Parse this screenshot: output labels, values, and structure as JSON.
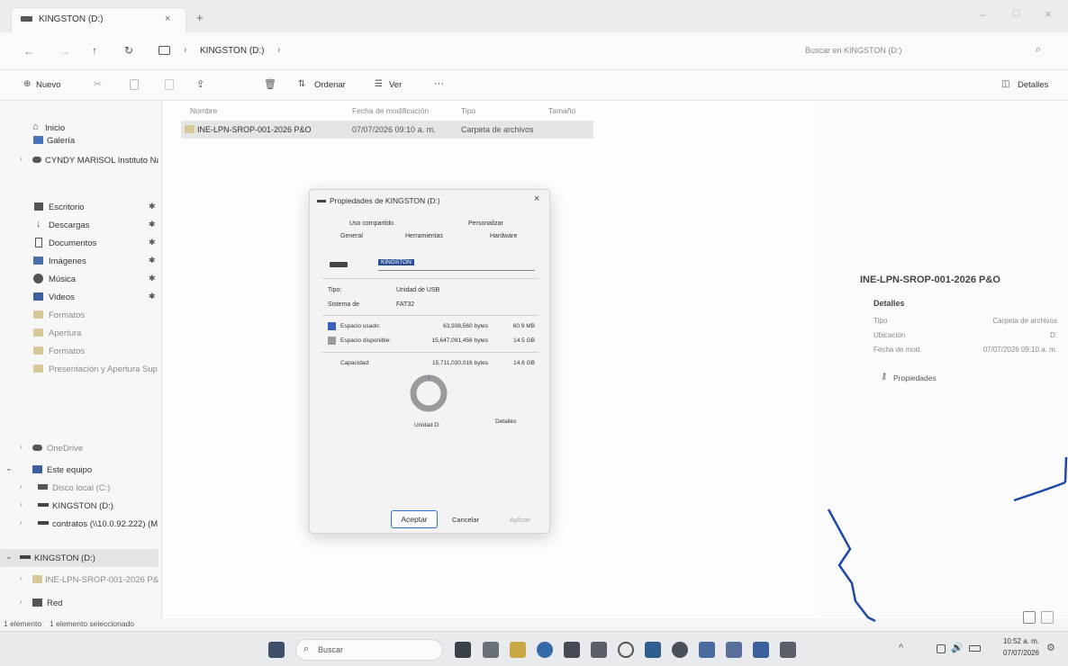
{
  "window": {
    "tab_title": "KINGSTON (D:)",
    "tab_close": "×",
    "new_tab": "+",
    "controls": [
      "–",
      "□",
      "×"
    ]
  },
  "addressbar": {
    "path": "KINGSTON (D:)",
    "search_placeholder": "Buscar en KINGSTON (D:)"
  },
  "toolbar": {
    "new_label": "Nuevo",
    "sort_label": "Ordenar",
    "view_label": "Ver",
    "more_label": "···",
    "details_label": "Detalles"
  },
  "sidebar": {
    "items": [
      {
        "label": "Inicio"
      },
      {
        "label": "Galería"
      },
      {
        "label": "CYNDY MARISOL Instituto Nal"
      },
      {
        "label": "Escritorio"
      },
      {
        "label": "Descargas"
      },
      {
        "label": "Documentos"
      },
      {
        "label": "Imágenes"
      },
      {
        "label": "Música"
      },
      {
        "label": "Videos"
      },
      {
        "label": "Formatos"
      },
      {
        "label": "Apertura"
      },
      {
        "label": "Formatos"
      },
      {
        "label": "Presentación y Apertura Sup Pl"
      },
      {
        "label": "OneDrive"
      },
      {
        "label": "Este equipo"
      },
      {
        "label": "Disco local (C:)"
      },
      {
        "label": "KINGSTON (D:)"
      },
      {
        "label": "contratos (\\\\10.0.92.222) (M"
      },
      {
        "label": "KINGSTON (D:)"
      },
      {
        "label": "INE-LPN-SROP-001-2026 P&"
      },
      {
        "label": "Red"
      }
    ],
    "pin_glyph": "✱"
  },
  "file_list": {
    "columns": [
      "Nombre",
      "Fecha de modificación",
      "Tipo",
      "Tamaño"
    ],
    "rows": [
      {
        "name": "INE-LPN-SROP-001-2026 P&O",
        "date": "07/07/2026 09:10 a. m.",
        "type": "Carpeta de archivos",
        "size": ""
      }
    ]
  },
  "dialog": {
    "title": "Propiedades de KINGSTON (D:)",
    "close": "×",
    "tabs_row1": [
      "Uso compartido",
      "Personalizar"
    ],
    "tabs_row2": [
      "General",
      "Herramientas",
      "Hardware"
    ],
    "volume_label": "KINGSTON",
    "type_label": "Tipo:",
    "type_value": "Unidad de USB",
    "fs_label": "Sistema de",
    "fs_value": "FAT32",
    "used_label": "Espacio usado:",
    "used_bytes": "63,938,560 bytes",
    "used_size": "60.9 MB",
    "free_label": "Espacio disponible:",
    "free_bytes": "15,647,091,456 bytes",
    "free_size": "14.5 GB",
    "capacity_label": "Capacidad:",
    "capacity_bytes": "15,711,030,016 bytes",
    "capacity_size": "14.6 GB",
    "used_fraction": 0.004,
    "drive_label": "Unidad D:",
    "details_button": "Detalles",
    "accept": "Aceptar",
    "cancel": "Cancelar",
    "apply": "Aplicar"
  },
  "details_pane": {
    "title": "INE-LPN-SROP-001-2026 P&O",
    "section": "Detalles",
    "rows": [
      {
        "k": "Tipo",
        "v": "Carpeta de archivos"
      },
      {
        "k": "Ubicación",
        "v": "D:"
      },
      {
        "k": "Fecha de mod.",
        "v": "07/07/2026 09:10 a. m."
      }
    ],
    "properties_link": "Propiedades"
  },
  "statusbar": {
    "count": "1 elemento",
    "selected": "1 elemento seleccionado"
  },
  "taskbar": {
    "search_placeholder": "Buscar",
    "time": "10:52 a. m.",
    "date": "07/07/2026",
    "tray_up": "^"
  },
  "colors": {
    "accent": "#2a6fd6",
    "used": "#3a5fc0",
    "free": "#9a9a9a",
    "pen": "#1f49a8"
  }
}
